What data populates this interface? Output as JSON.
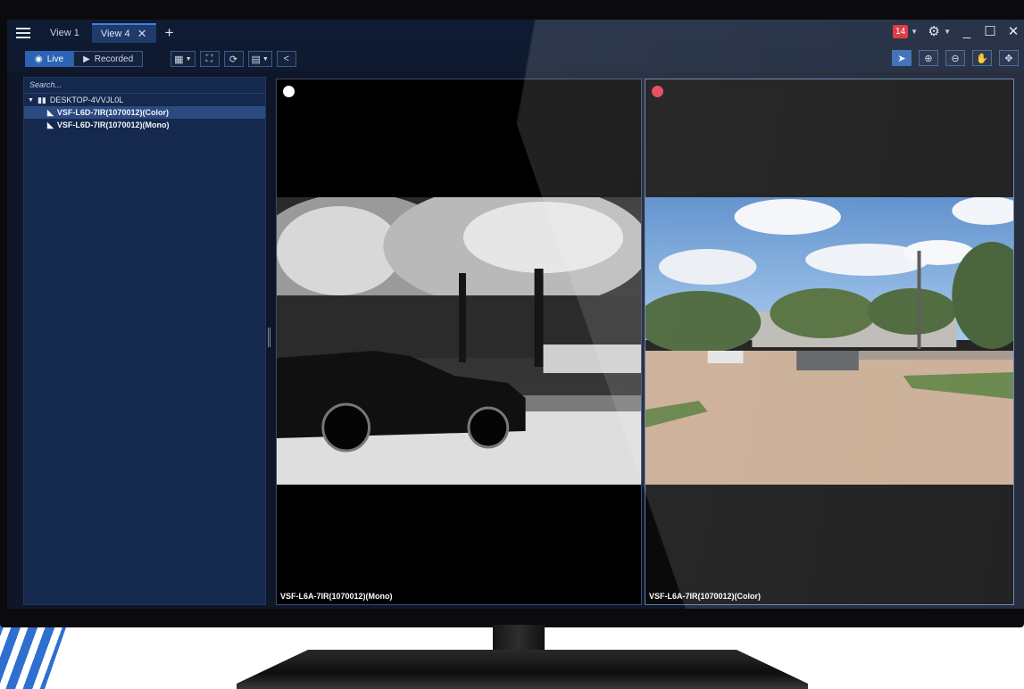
{
  "tabs": [
    {
      "label": "View 1"
    },
    {
      "label": "View 4"
    }
  ],
  "titlebar": {
    "notification_count": "14"
  },
  "toolbar": {
    "live_label": "Live",
    "recorded_label": "Recorded"
  },
  "sidebar": {
    "search_placeholder": "Search...",
    "server_name": "DESKTOP-4VVJL0L",
    "cameras": [
      {
        "label": "VSF-L6D-7IR(1070012)(Color)"
      },
      {
        "label": "VSF-L6D-7IR(1070012)(Mono)"
      }
    ]
  },
  "tiles": [
    {
      "label": "VSF-L6A-7IR(1070012)(Mono)",
      "status_color": "#ffffff"
    },
    {
      "label": "VSF-L6A-7IR(1070012)(Color)",
      "status_color": "#e23a4a"
    }
  ],
  "colors": {
    "accent": "#2c63b4",
    "sidebar_bg": "#15284d",
    "app_bg": "#0e1628"
  }
}
